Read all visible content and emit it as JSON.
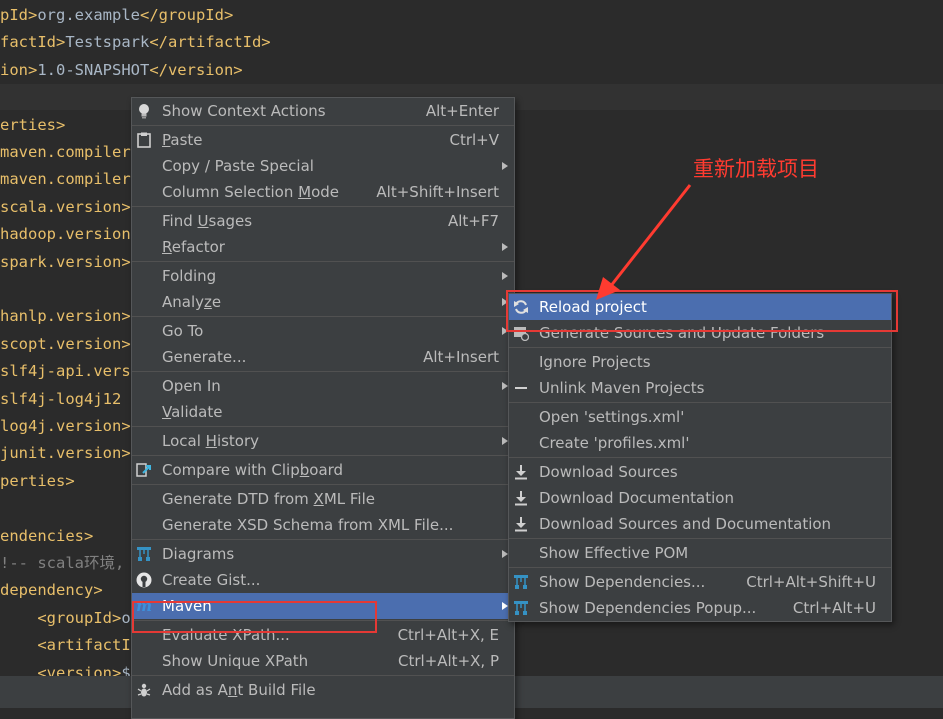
{
  "editor": {
    "lines": [
      {
        "tag_open": "pId>",
        "text": "org.example",
        "tag_close": "</groupId>"
      },
      {
        "tag_open": "factId>",
        "text": "Testspark",
        "tag_close": "</artifactId>"
      },
      {
        "tag_open": "ion>",
        "text": "1.0-SNAPSHOT",
        "tag_close": "</version>"
      },
      {
        "tag_open": "",
        "text": "",
        "tag_close": ""
      },
      {
        "tag_open": "erties>",
        "text": "",
        "tag_close": ""
      },
      {
        "tag_open": "maven.compiler",
        "text": "",
        "tag_close": ""
      },
      {
        "tag_open": "maven.compiler",
        "text": "",
        "tag_close": ""
      },
      {
        "tag_open": "scala.version>",
        "text": "",
        "tag_close": ""
      },
      {
        "tag_open": "hadoop.version",
        "text": "",
        "tag_close": ""
      },
      {
        "tag_open": "spark.version>",
        "text": "",
        "tag_close": ""
      },
      {
        "tag_open": "",
        "text": "",
        "tag_close": ""
      },
      {
        "tag_open": "hanlp.version>",
        "text": "",
        "tag_close": ""
      },
      {
        "tag_open": "scopt.version>",
        "text": "",
        "tag_close": ""
      },
      {
        "tag_open": "slf4j-api.vers",
        "text": "",
        "tag_close": ""
      },
      {
        "tag_open": "slf4j-log4j12",
        "text": "",
        "tag_close": ""
      },
      {
        "tag_open": "log4j.version>",
        "text": "",
        "tag_close": ""
      },
      {
        "tag_open": "junit.version>",
        "text": "",
        "tag_close": ""
      },
      {
        "tag_open": "perties>",
        "text": "",
        "tag_close": ""
      },
      {
        "tag_open": "",
        "text": "",
        "tag_close": ""
      },
      {
        "tag_open": "endencies>",
        "text": "",
        "tag_close": ""
      },
      {
        "comment": "!-- scala环境,"
      },
      {
        "tag_open": "dependency>",
        "text": "",
        "tag_close": ""
      },
      {
        "tag_open": "    <groupId>",
        "text": "or",
        "tag_close": ""
      },
      {
        "tag_open": "    <artifactI",
        "text": "",
        "tag_close": ""
      },
      {
        "tag_open": "    <version>",
        "text": "$",
        "tag_close": ""
      }
    ]
  },
  "context_menu": {
    "groups": [
      [
        {
          "icon": "bulb",
          "label": "Show Context Actions",
          "shortcut": "Alt+Enter"
        }
      ],
      [
        {
          "icon": "paste",
          "label": "Paste",
          "u": 0,
          "shortcut": "Ctrl+V"
        },
        {
          "label": "Copy / Paste Special",
          "submenu": true
        },
        {
          "label": "Column Selection Mode",
          "u": 17,
          "shortcut": "Alt+Shift+Insert"
        }
      ],
      [
        {
          "label": "Find Usages",
          "u": 5,
          "shortcut": "Alt+F7"
        },
        {
          "label": "Refactor",
          "u": 0,
          "submenu": true
        }
      ],
      [
        {
          "label": "Folding",
          "submenu": true
        },
        {
          "label": "Analyze",
          "u": 5,
          "submenu": true
        }
      ],
      [
        {
          "label": "Go To",
          "submenu": true
        },
        {
          "label": "Generate...",
          "shortcut": "Alt+Insert"
        }
      ],
      [
        {
          "label": "Open In",
          "submenu": true
        },
        {
          "label": "Validate",
          "u": 0
        }
      ],
      [
        {
          "label": "Local History",
          "u": 6,
          "submenu": true
        }
      ],
      [
        {
          "icon": "compare",
          "label": "Compare with Clipboard",
          "u": 17
        }
      ],
      [
        {
          "label": "Generate DTD from XML File",
          "u": 18
        },
        {
          "label": "Generate XSD Schema from XML File..."
        }
      ],
      [
        {
          "icon": "diagram",
          "label": "Diagrams",
          "submenu": true
        },
        {
          "icon": "github",
          "label": "Create Gist..."
        },
        {
          "icon": "maven",
          "label": "Maven",
          "submenu": true,
          "selected": true
        }
      ],
      [
        {
          "label": "Evaluate XPath...",
          "shortcut": "Ctrl+Alt+X, E"
        },
        {
          "label": "Show Unique XPath",
          "shortcut": "Ctrl+Alt+X, P"
        }
      ],
      [
        {
          "icon": "ant",
          "label": "Add as Ant Build File",
          "u": 8
        }
      ]
    ]
  },
  "maven_submenu": {
    "groups": [
      [
        {
          "icon": "reload",
          "label": "Reload project",
          "selected": true
        },
        {
          "icon": "generate",
          "label": "Generate Sources and Update Folders"
        }
      ],
      [
        {
          "label": "Ignore Projects"
        },
        {
          "icon": "minus",
          "label": "Unlink Maven Projects"
        }
      ],
      [
        {
          "label": "Open 'settings.xml'"
        },
        {
          "label": "Create 'profiles.xml'"
        }
      ],
      [
        {
          "icon": "download",
          "label": "Download Sources"
        },
        {
          "icon": "download",
          "label": "Download Documentation"
        },
        {
          "icon": "download",
          "label": "Download Sources and Documentation"
        }
      ],
      [
        {
          "label": "Show Effective POM"
        }
      ],
      [
        {
          "icon": "diagram",
          "label": "Show Dependencies...",
          "shortcut": "Ctrl+Alt+Shift+U"
        },
        {
          "icon": "diagram",
          "label": "Show Dependencies Popup...",
          "shortcut": "Ctrl+Alt+U"
        }
      ]
    ]
  },
  "annotation": {
    "text": "重新加载项目",
    "color": "#ff3b30"
  },
  "colors": {
    "editor_bg": "#2b2b2b",
    "menu_bg": "#3c3f41",
    "selection": "#4b6eaf",
    "xml_tag": "#e8bf6a",
    "text": "#a9b7c6",
    "comment": "#808080"
  }
}
